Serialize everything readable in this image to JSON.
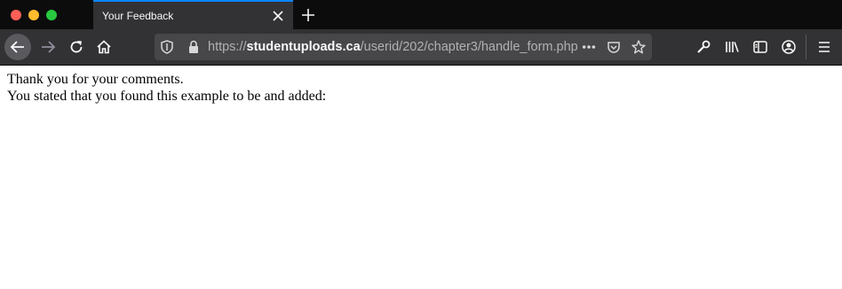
{
  "window": {
    "traffic_lights": [
      "close",
      "minimize",
      "maximize"
    ]
  },
  "tab": {
    "title": "Your Feedback",
    "accent_color": "#0a84ff"
  },
  "toolbar": {
    "icons": [
      "back-icon",
      "forward-icon",
      "reload-icon",
      "home-icon"
    ],
    "right_icons": [
      "wrench-icon",
      "library-icon",
      "sidebar-icon",
      "account-icon",
      "menu-icon"
    ]
  },
  "urlbar": {
    "scheme": "https://",
    "host": "studentuploads.ca",
    "path": "/userid/202/chapter3/handle_form.php",
    "icons": [
      "shield-icon",
      "lock-icon",
      "page-actions-icon",
      "pocket-icon",
      "bookmark-star-icon"
    ]
  },
  "page": {
    "line1": "Thank you for your comments.",
    "line2": "You stated that you found this example to be and added:"
  }
}
